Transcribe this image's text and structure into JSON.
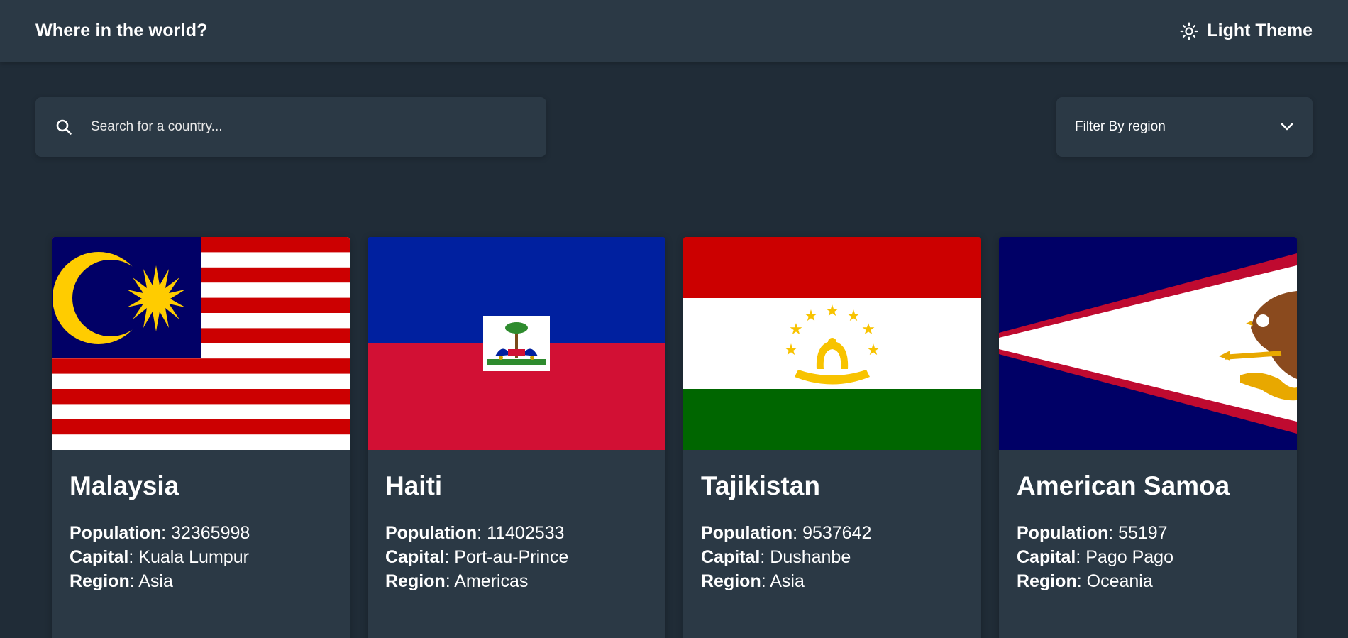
{
  "header": {
    "title": "Where in the world?",
    "theme_toggle_label": "Light Theme",
    "theme_icon": "sun-icon"
  },
  "search": {
    "placeholder": "Search for a country...",
    "value": "",
    "icon": "search-icon"
  },
  "filter": {
    "label": "Filter By region",
    "icon": "chevron-down-icon"
  },
  "labels": {
    "population": "Population",
    "capital": "Capital",
    "region": "Region",
    "separator": ": "
  },
  "countries": [
    {
      "name": "Malaysia",
      "population": "32365998",
      "capital": "Kuala Lumpur",
      "region": "Asia",
      "flag": "malaysia-flag"
    },
    {
      "name": "Haiti",
      "population": "11402533",
      "capital": "Port-au-Prince",
      "region": "Americas",
      "flag": "haiti-flag"
    },
    {
      "name": "Tajikistan",
      "population": "9537642",
      "capital": "Dushanbe",
      "region": "Asia",
      "flag": "tajikistan-flag"
    },
    {
      "name": "American Samoa",
      "population": "55197",
      "capital": "Pago Pago",
      "region": "Oceania",
      "flag": "american-samoa-flag"
    }
  ],
  "colors": {
    "background": "#202c37",
    "elements": "#2b3945",
    "text": "#ffffff"
  }
}
